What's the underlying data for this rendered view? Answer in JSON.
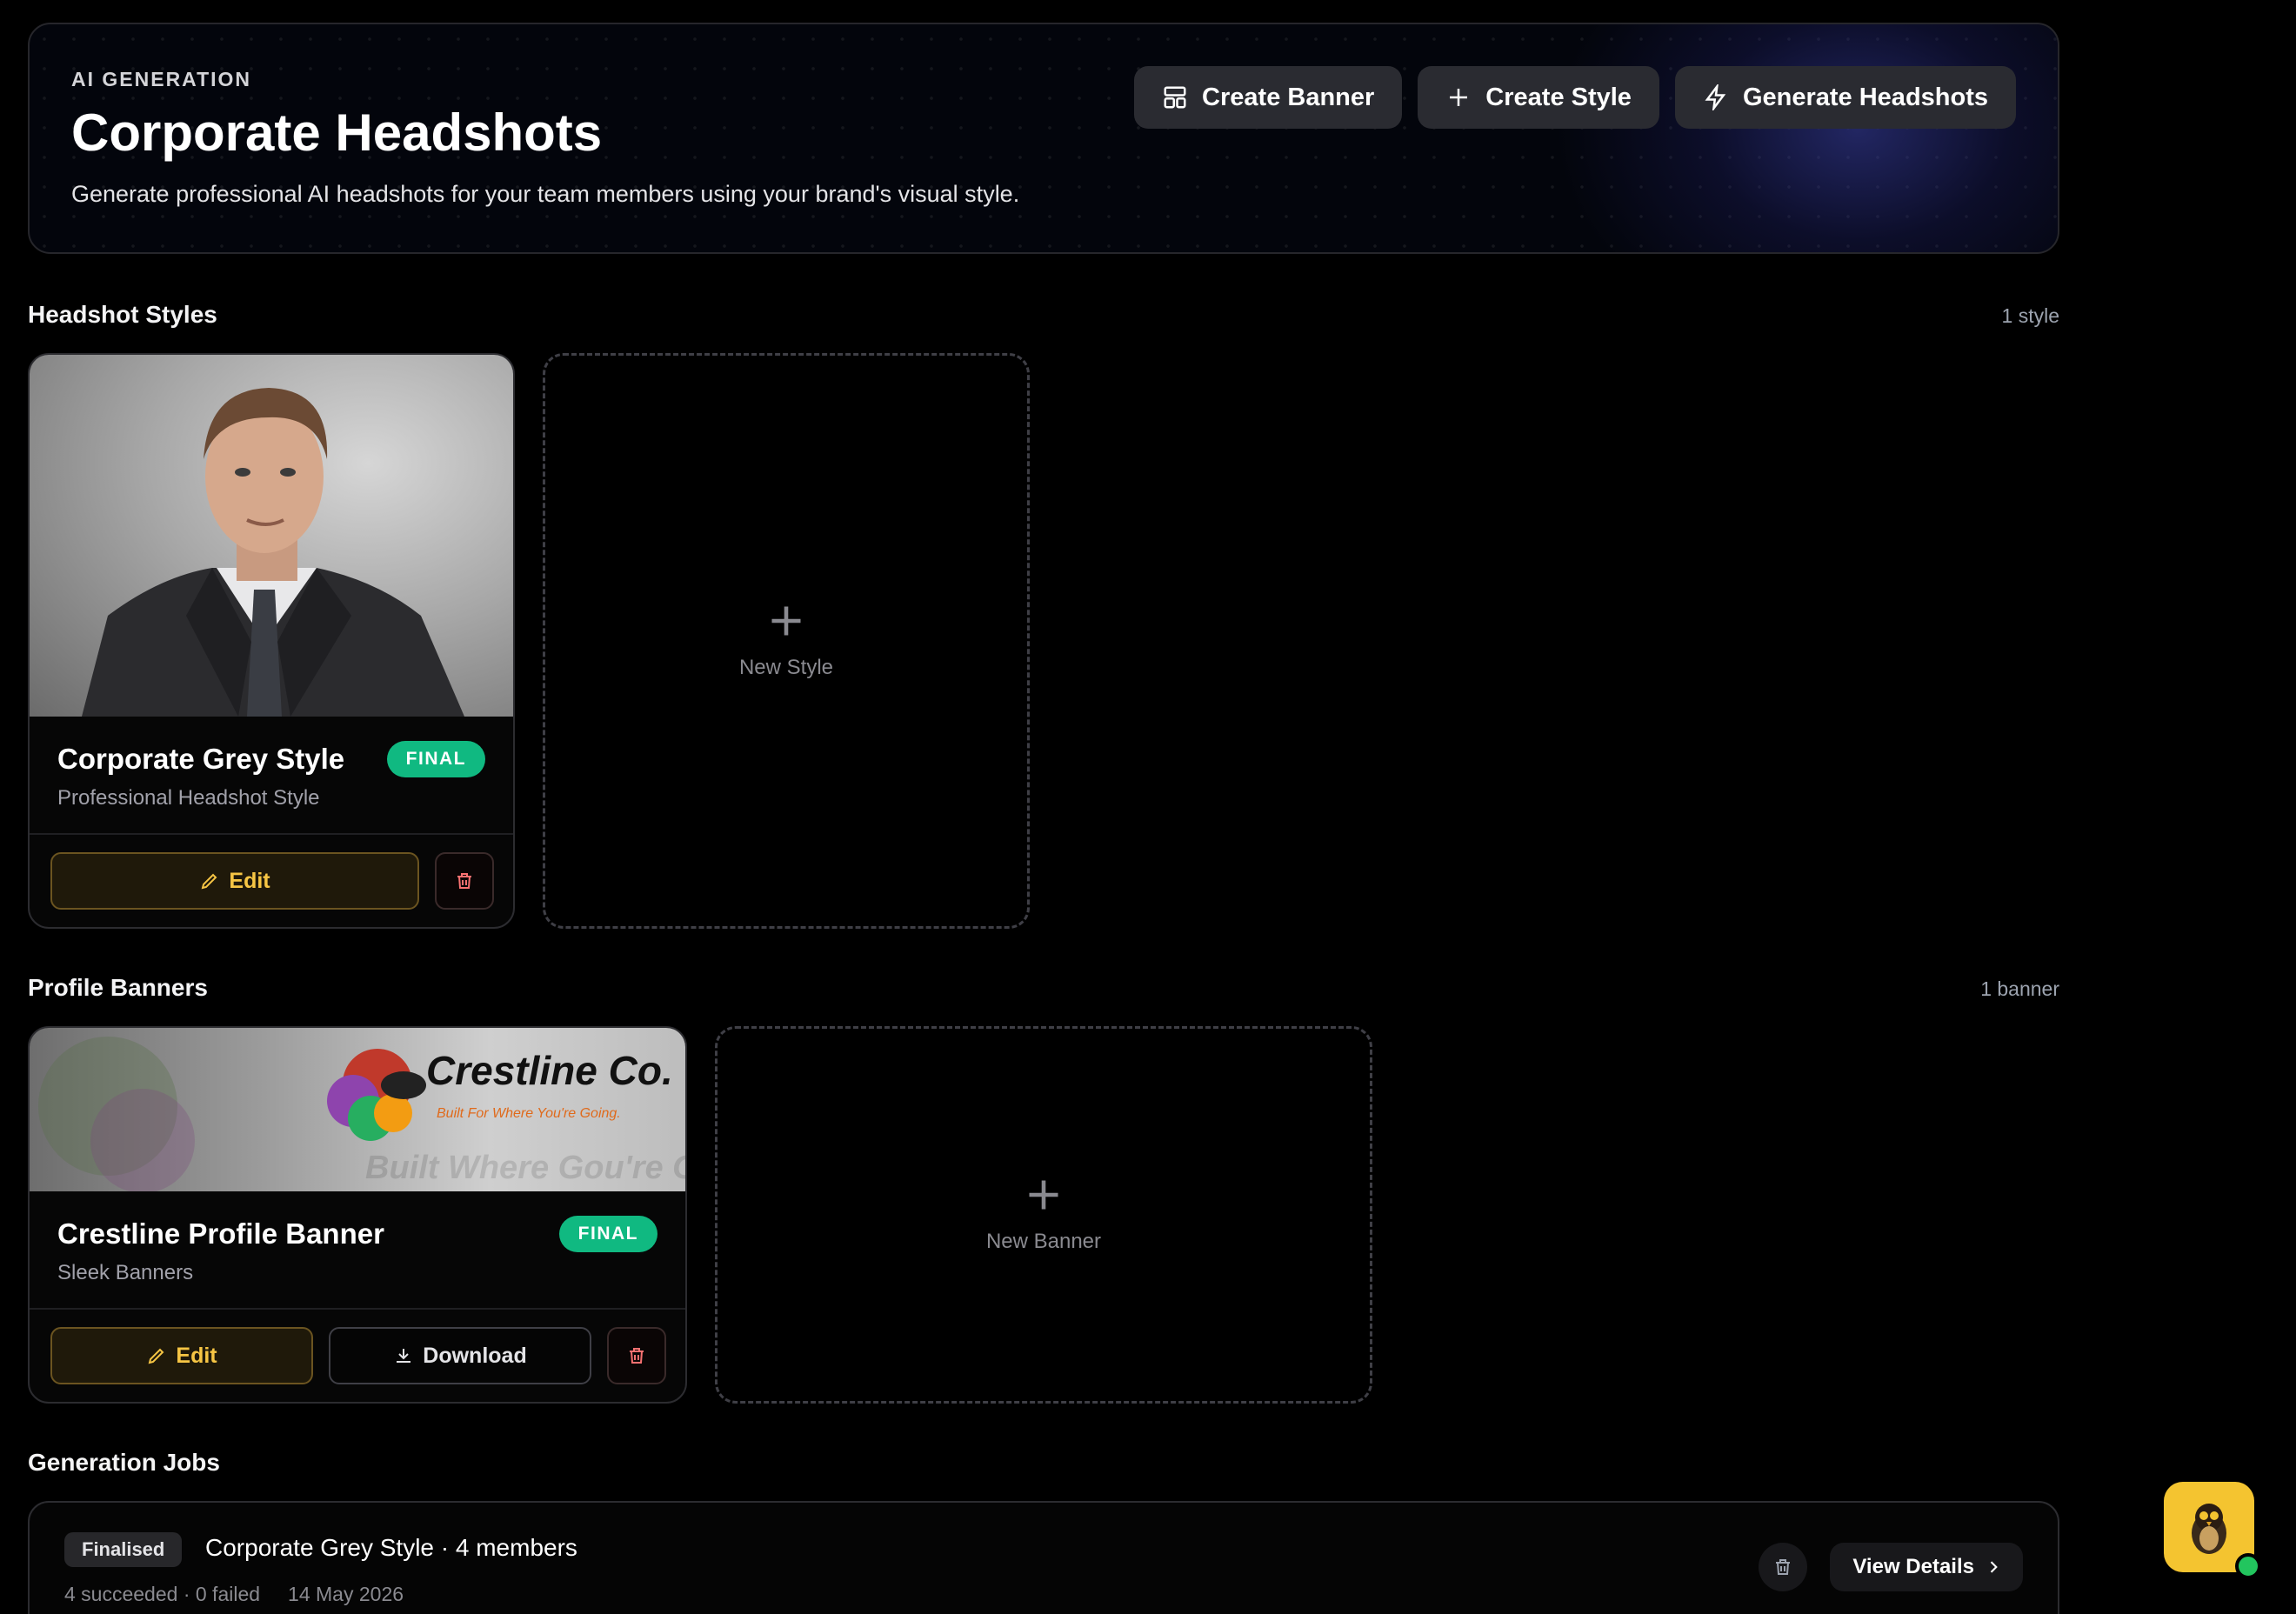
{
  "header": {
    "eyebrow": "AI GENERATION",
    "title": "Corporate Headshots",
    "subtitle": "Generate professional AI headshots for your team members using your brand's visual style.",
    "actions": [
      {
        "label": "Create Banner",
        "icon": "layout-icon"
      },
      {
        "label": "Create Style",
        "icon": "plus-icon"
      },
      {
        "label": "Generate Headshots",
        "icon": "lightning-icon"
      }
    ]
  },
  "styles": {
    "title": "Headshot Styles",
    "count": "1 style",
    "card": {
      "name": "Corporate Grey Style",
      "subtitle": "Professional Headshot Style",
      "badge": "FINAL",
      "edit_label": "Edit"
    },
    "new_label": "New Style"
  },
  "banners": {
    "title": "Profile Banners",
    "count": "1 banner",
    "card": {
      "name": "Crestline Profile Banner",
      "subtitle": "Sleek Banners",
      "badge": "FINAL",
      "edit_label": "Edit",
      "download_label": "Download",
      "brand_text": "Crestline Co.",
      "brand_tagline": "Built For Where You're Going.",
      "bg_text": "Built Where Gou're G"
    },
    "new_label": "New Banner"
  },
  "jobs": {
    "title": "Generation Jobs",
    "items": [
      {
        "status": "Finalised",
        "title": "Corporate Grey Style · 4 members",
        "results": "4 succeeded · 0 failed",
        "date": "14 May 2026",
        "view_label": "View Details"
      }
    ]
  },
  "colors": {
    "accent_green": "#10b981",
    "edit_gold": "#f6c544",
    "fab_yellow": "#f4c430"
  }
}
